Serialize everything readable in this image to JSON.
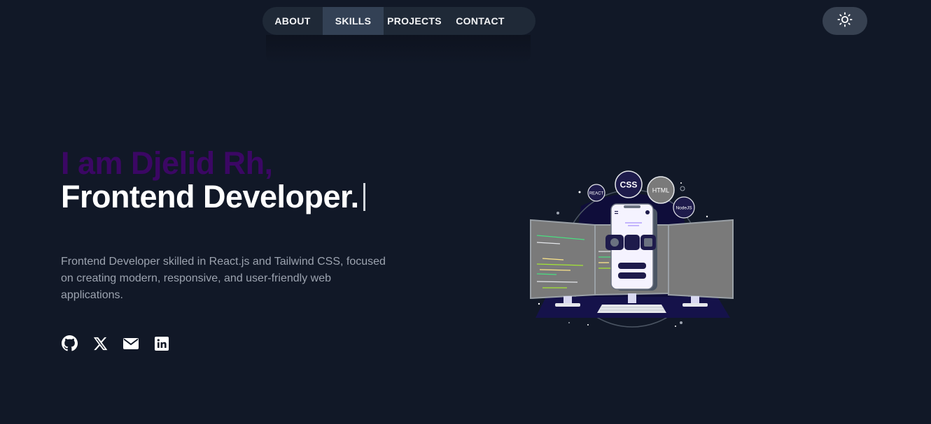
{
  "nav": {
    "items": [
      {
        "label": "ABOUT"
      },
      {
        "label": "SKILLS"
      },
      {
        "label": "PROJECTS"
      },
      {
        "label": "CONTACT"
      }
    ],
    "active_index": 1
  },
  "theme_toggle": {
    "icon": "sun-icon"
  },
  "hero": {
    "greeting": "I am Djelid Rh,",
    "role": "Frontend Developer.",
    "description": "Frontend Developer skilled in React.js and Tailwind CSS, focused on creating modern, responsive, and user-friendly web applications."
  },
  "socials": [
    {
      "icon": "github-icon"
    },
    {
      "icon": "x-icon"
    },
    {
      "icon": "mail-icon"
    },
    {
      "icon": "linkedin-icon"
    }
  ],
  "illustration": {
    "badges": [
      "REACT",
      "CSS",
      "HTML",
      "NodeJS"
    ]
  },
  "colors": {
    "background": "#111827",
    "nav_bg": "#1f2937",
    "nav_active": "#334155",
    "greeting": "#3b0764",
    "role": "#ffffff",
    "description": "#9ca3af"
  }
}
